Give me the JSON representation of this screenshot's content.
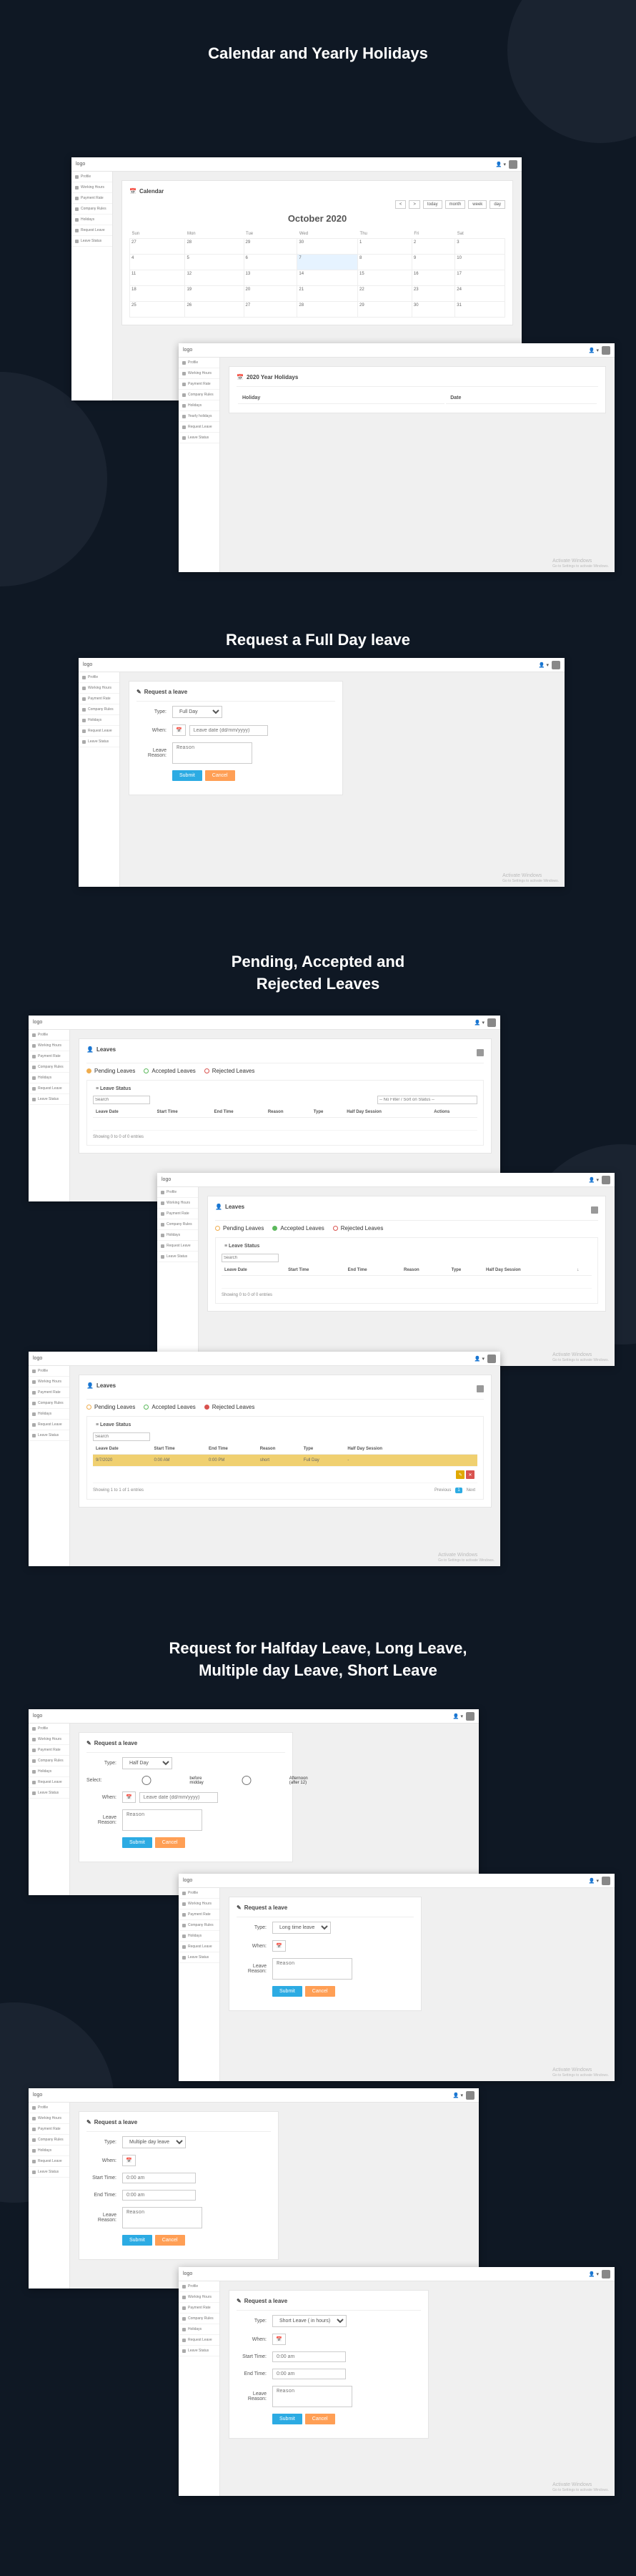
{
  "headings": {
    "sec1": "Calendar and Yearly Holidays",
    "sec2": "Request a Full Day leave",
    "sec3_line1": "Pending, Accepted and",
    "sec3_line2": "Rejected Leaves",
    "sec4_line1": "Request for Halfday Leave, Long Leave,",
    "sec4_line2": "Multiple day Leave, Short Leave"
  },
  "logo": "logo",
  "user_menu": "👤 ▾",
  "sidebar": {
    "items": [
      "Profile",
      "Working Hours",
      "Payment Rate",
      "Company Rules",
      "Holidays",
      "Yearly holidays",
      "Request Leave",
      "Leave Status"
    ]
  },
  "calendar": {
    "panel_title": "Calendar",
    "nav": {
      "today": "today",
      "prev": "<",
      "next": ">",
      "month": "month",
      "week": "week",
      "day": "day"
    },
    "month_title": "October 2020",
    "days": [
      "Sun",
      "Mon",
      "Tue",
      "Wed",
      "Thu",
      "Fri",
      "Sat"
    ],
    "cells": [
      [
        "27",
        "28",
        "29",
        "30",
        "1",
        "2",
        "3"
      ],
      [
        "4",
        "5",
        "6",
        "7",
        "8",
        "9",
        "10"
      ],
      [
        "11",
        "12",
        "13",
        "14",
        "15",
        "16",
        "17"
      ],
      [
        "18",
        "19",
        "20",
        "21",
        "22",
        "23",
        "24"
      ],
      [
        "25",
        "26",
        "27",
        "28",
        "29",
        "30",
        "31"
      ]
    ],
    "today": "7"
  },
  "holidays": {
    "panel_title": "2020 Year Holidays",
    "cols": [
      "Holiday",
      "Date"
    ]
  },
  "request": {
    "panel_title": "Request a leave",
    "labels": {
      "type": "Type:",
      "when": "When:",
      "reason": "Leave Reason:",
      "select": "Select:",
      "start": "Start Time:",
      "end": "End Time:"
    },
    "submit": "Submit",
    "cancel": "Cancel",
    "placeholder_date": "Leave date (dd/mm/yyyy)",
    "placeholder_reason": "Reason",
    "placeholder_time": "0:00 am",
    "before": "before midday",
    "after": "Afternoon (after 12)",
    "types": {
      "full": "Full Day",
      "half": "Half Day",
      "long": "Long time leave",
      "multi": "Multiple day leave",
      "short": "Short Leave ( in hours)"
    }
  },
  "leaves": {
    "panel_title": "Leaves",
    "sub_title": "Leave Status",
    "tabs": {
      "pending": "Pending Leaves",
      "accepted": "Accepted Leaves",
      "rejected": "Rejected Leaves"
    },
    "search_ph": "Search",
    "filter_ph": "-- No Filter / Sort on Status --",
    "cols": [
      "Leave Date",
      "Start Time",
      "End Time",
      "Reason",
      "Type",
      "Half Day Session",
      "Actions"
    ],
    "no_entries": "Showing 0 to 0 of 0 entries",
    "one_entry": "Showing 1 to 1 of 1 entries",
    "sample_row": {
      "date": "9/7/2020",
      "start": "0:00 AM",
      "end": "0:00 PM",
      "reason": "short",
      "type": "Full Day",
      "session": "-"
    },
    "prev": "Previous",
    "next": "Next",
    "page1": "1"
  },
  "watermark": {
    "title": "Activate Windows",
    "sub": "Go to Settings to activate Windows."
  }
}
